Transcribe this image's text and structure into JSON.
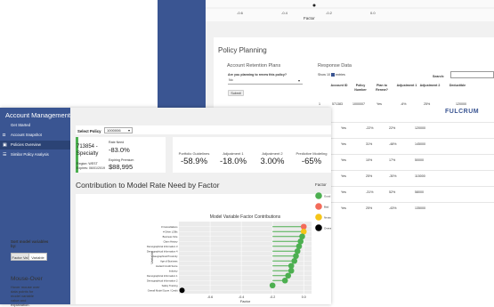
{
  "back_window": {
    "top_axis": {
      "ticks": [
        "-0.6",
        "-0.4",
        "-0.2",
        "0.0"
      ],
      "xlabel": "Factor"
    },
    "policy_planning": {
      "title": "Policy Planning",
      "retention": {
        "heading": "Account Retention Plans",
        "question": "Are you planning to renew this policy?",
        "select_value": "No",
        "submit_label": "Submit"
      },
      "response": {
        "heading": "Response Data",
        "show_prefix": "Show",
        "show_count": "10",
        "show_suffix": "entries",
        "search_label": "Search:",
        "columns": [
          "Account ID",
          "Policy Number",
          "Plan to Renew?",
          "Adjustment 1",
          "Adjustment 2",
          "Deductible"
        ],
        "first_row": [
          "571383",
          "1000007"
        ],
        "first_row_index": "1",
        "rows": [
          {
            "renew": "Yes",
            "adj1": "-6%",
            "adj2": "25%",
            "deductible": "120000"
          },
          {
            "renew": "Yes",
            "adj1": "-22%",
            "adj2": "22%",
            "deductible": "120000"
          },
          {
            "renew": "Yes",
            "adj1": "31%",
            "adj2": "-48%",
            "deductible": "145000"
          },
          {
            "renew": "Yes",
            "adj1": "10%",
            "adj2": "17%",
            "deductible": "50000"
          },
          {
            "renew": "Yes",
            "adj1": "25%",
            "adj2": "-30%",
            "deductible": "115000"
          },
          {
            "renew": "Yes",
            "adj1": "-31%",
            "adj2": "52%",
            "deductible": "58000"
          },
          {
            "renew": "Yes",
            "adj1": "25%",
            "adj2": "-43%",
            "deductible": "135000"
          }
        ]
      },
      "brand": "FULCRUM"
    }
  },
  "sidebar": {
    "title": "Account Management",
    "get_started": "Get Started",
    "items": [
      {
        "label": "Account Snapshot",
        "icon": "camera-icon",
        "glyph": "◘"
      },
      {
        "label": "Policies Overview",
        "icon": "dashboard-icon",
        "glyph": "▣"
      },
      {
        "label": "Similar Policy Analysis",
        "icon": "list-icon",
        "glyph": "☰"
      }
    ]
  },
  "select_policy": {
    "label": "Select Policy",
    "value": "1000006"
  },
  "policy_card": {
    "id_line": "713854 -",
    "name": "Specialty",
    "region": "Region: WEST",
    "expires": "Expires: 06/01/2019",
    "rate_need_label": "Rate Need",
    "rate_need_value": "-83.0%",
    "expiring_premium_label": "Expiring Premium",
    "expiring_premium_value": "$88,995"
  },
  "stats": [
    {
      "label": "Portfolio Guidelines",
      "value": "-58.9%"
    },
    {
      "label": "Adjustment 1",
      "value": "-18.0%"
    },
    {
      "label": "Adjustment 2",
      "value": "3.00%"
    },
    {
      "label": "Predictive Modeling",
      "value": "-65%"
    }
  ],
  "section_title": "Contribution to Model Rate Need by Factor",
  "sort": {
    "label": "Sort model variables by:",
    "buttons": [
      "Factor Val",
      "Variable"
    ]
  },
  "mouse_over": {
    "title": "Mouse-Over",
    "desc": "Hover mouse over data points for model variable value and explanation."
  },
  "colors": {
    "sidebar": "#3a5592",
    "good": "#4caf50",
    "bad": "#f36b5a",
    "neutral": "#f5c518",
    "overall": "#000000"
  },
  "chart_data": {
    "type": "scatter",
    "title": "Model Variable Factor Contributions",
    "xlabel": "Factor",
    "ylabel": "Variable",
    "xlim": [
      -0.8,
      0.05
    ],
    "xticks": [
      "-0.6",
      "-0.4",
      "-0.2",
      "0.0"
    ],
    "legend_title": "Factor",
    "legend_position": "right",
    "legend": [
      {
        "label": "Good",
        "color": "#4caf50"
      },
      {
        "label": "Bad",
        "color": "#f36b5a"
      },
      {
        "label": "Neutral",
        "color": "#f5c518"
      },
      {
        "label": "Overall Model Factor",
        "color": "#000000"
      }
    ],
    "points": [
      {
        "label": "# Cancellations",
        "x": 0.0,
        "cls": "Bad"
      },
      {
        "label": "# Other LOBs",
        "x": 0.0,
        "cls": "Neutral"
      },
      {
        "label": "Business Size",
        "x": -0.01,
        "cls": "Good"
      },
      {
        "label": "Claim History",
        "x": -0.02,
        "cls": "Good"
      },
      {
        "label": "Demographical Information 3",
        "x": -0.03,
        "cls": "Good"
      },
      {
        "label": "Demographical Information 4",
        "x": -0.04,
        "cls": "Good"
      },
      {
        "label": "Geographical Proximity",
        "x": -0.05,
        "cls": "Good"
      },
      {
        "label": "Age of Business",
        "x": -0.06,
        "cls": "Good"
      },
      {
        "label": "Hazard Credit Score",
        "x": -0.08,
        "cls": "Good"
      },
      {
        "label": "Industry",
        "x": -0.08,
        "cls": "Good"
      },
      {
        "label": "Demographical Information 1",
        "x": -0.1,
        "cls": "Good"
      },
      {
        "label": "Demographical Information 2",
        "x": -0.12,
        "cls": "Good"
      },
      {
        "label": "Safety Training",
        "x": -0.2,
        "cls": "Good"
      },
      {
        "label": "Overall Model Score / Credit",
        "x": -0.78,
        "cls": "Overall Model Factor"
      }
    ]
  }
}
